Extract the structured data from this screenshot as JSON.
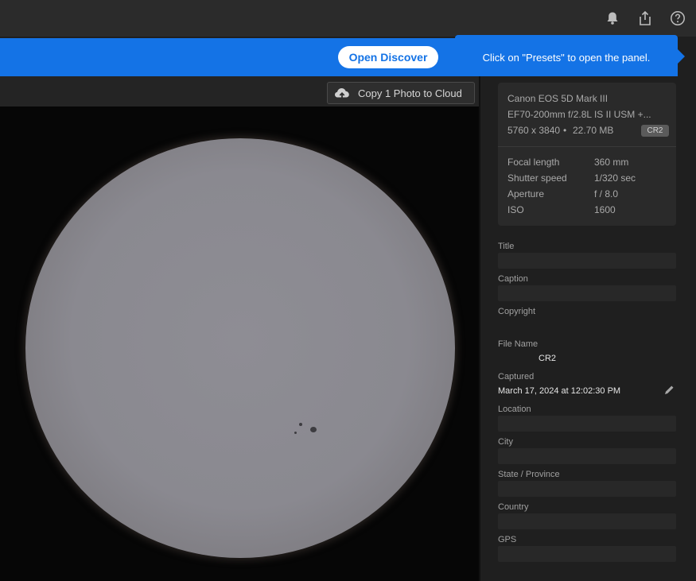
{
  "topbar": {
    "icons": [
      "bell-icon",
      "share-icon",
      "help-icon"
    ]
  },
  "banner": {
    "button_label": "Open Discover"
  },
  "tooltip": {
    "text": "Click on \"Presets\" to open the panel."
  },
  "toolbar": {
    "copy_label": "Copy 1 Photo to Cloud",
    "copy_icon": "cloud-upload-icon"
  },
  "info": {
    "camera": "Canon EOS 5D Mark III",
    "lens": "EF70-200mm f/2.8L IS II USM +...",
    "dimensions": "5760 x 3840",
    "separator": "•",
    "size": "22.70 MB",
    "format": "CR2",
    "exif": [
      {
        "label": "Focal length",
        "value": "360 mm"
      },
      {
        "label": "Shutter speed",
        "value": "1/320 sec"
      },
      {
        "label": "Aperture",
        "value": "f / 8.0"
      },
      {
        "label": "ISO",
        "value": "1600"
      }
    ]
  },
  "fields": {
    "title_label": "Title",
    "caption_label": "Caption",
    "copyright_label": "Copyright",
    "filename_label": "File Name",
    "filename_value": "CR2",
    "captured_label": "Captured",
    "captured_value": "March 17, 2024 at 12:02:30 PM",
    "location_label": "Location",
    "city_label": "City",
    "state_label": "State / Province",
    "country_label": "Country",
    "gps_label": "GPS"
  },
  "colors": {
    "accent": "#1473e6",
    "panel": "#1f1f1f",
    "card": "#2a2a2a"
  }
}
